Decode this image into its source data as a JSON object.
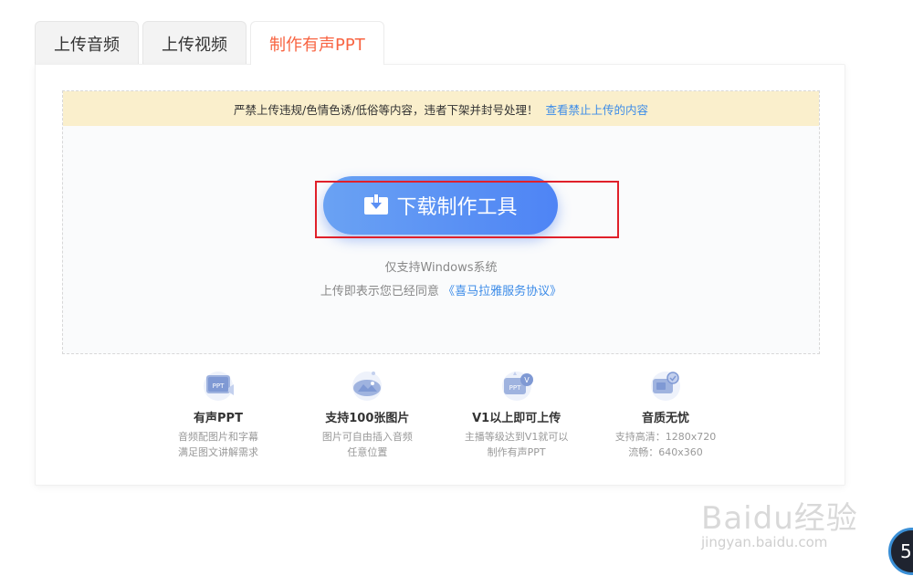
{
  "tabs": [
    {
      "label": "上传音频",
      "active": false
    },
    {
      "label": "上传视频",
      "active": false
    },
    {
      "label": "制作有声PPT",
      "active": true
    }
  ],
  "notice": {
    "text": "严禁上传违规/色情色诱/低俗等内容，违者下架并封号处理！",
    "link": "查看禁止上传的内容"
  },
  "download": {
    "label": "下载制作工具",
    "support": "仅支持Windows系统",
    "agree_prefix": "上传即表示您已经同意",
    "agree_link": "《喜马拉雅服务协议》"
  },
  "features": [
    {
      "icon": "ppt-icon",
      "title": "有声PPT",
      "desc1": "音频配图片和字幕",
      "desc2": "满足图文讲解需求"
    },
    {
      "icon": "image-icon",
      "title": "支持100张图片",
      "desc1": "图片可自由插入音频",
      "desc2": "任意位置"
    },
    {
      "icon": "v1-ppt-icon",
      "title": "V1以上即可上传",
      "desc1": "主播等级达到V1就可以",
      "desc2": "制作有声PPT"
    },
    {
      "icon": "quality-icon",
      "title": "音质无忧",
      "desc1": "支持高清：1280x720",
      "desc2": "流畅：640x360"
    }
  ],
  "watermark": {
    "logo": "Baidu经验",
    "sub": "jingyan.baidu.com"
  },
  "badge": {
    "text": "5"
  },
  "colors": {
    "accent": "#f86442",
    "link": "#3d8ce8",
    "button": "#5a8ff4",
    "notice_bg": "#faefcc",
    "highlight": "#e0202a"
  }
}
